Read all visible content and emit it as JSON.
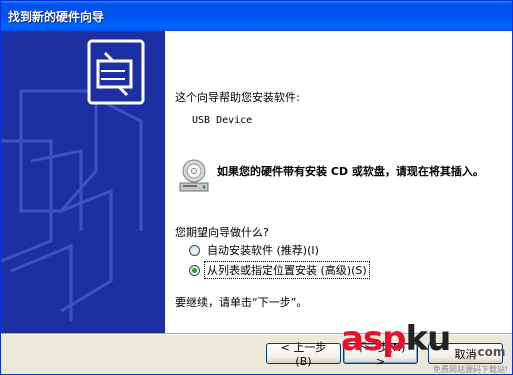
{
  "window": {
    "title": "找到新的硬件向导"
  },
  "content": {
    "intro": "这个向导帮助您安装软件:",
    "device_name": "USB Device",
    "cd_note": "如果您的硬件带有安装 CD 或软盘，请现在将其插入。",
    "question": "您期望向导做什么?",
    "options": [
      {
        "label": "自动安装软件 (推荐)(I)",
        "selected": false
      },
      {
        "label": "从列表或指定位置安装 (高级)(S)",
        "selected": true
      }
    ],
    "continue_hint": "要继续，请单击“下一步”。"
  },
  "buttons": {
    "back": "< 上一步(B)",
    "next": "下一步(N) >",
    "cancel": "取消"
  },
  "watermark": {
    "logo_asp": "asp",
    "logo_ku": "ku",
    "dotcom": ".com",
    "tagline": "免费网站源码下载站!"
  },
  "colors": {
    "banner_blue": "#1c2fa3",
    "watermark_red": "#e8102a",
    "watermark_dark": "#222222"
  }
}
